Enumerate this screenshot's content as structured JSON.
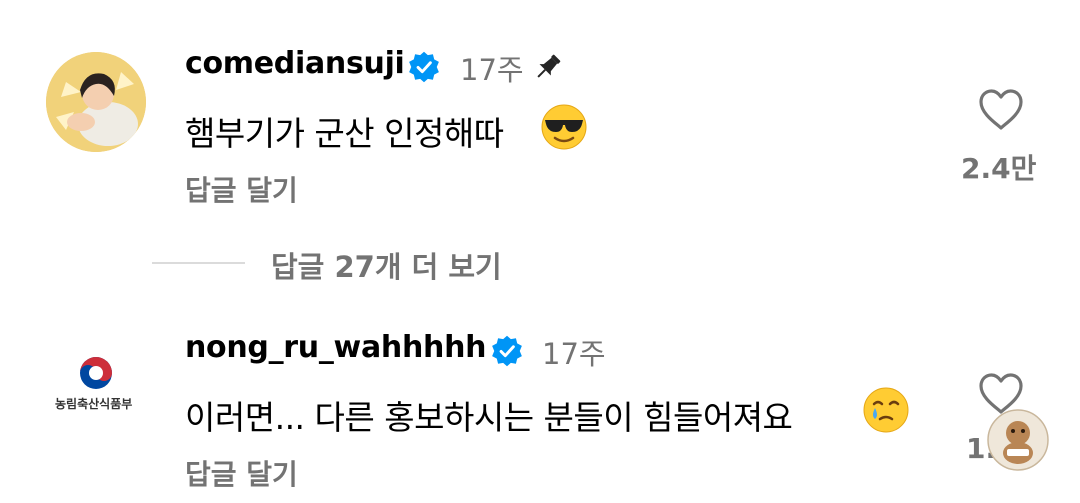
{
  "comments": [
    {
      "username": "comediansuji",
      "time": "17주",
      "text": "햄부기가 군산 인정해따",
      "reply_label": "답글 달기",
      "likes": "2.4만",
      "pinned": true,
      "verified": true,
      "emoji": "smiling-face-with-sunglasses"
    },
    {
      "username": "nong_ru_wahhhhh",
      "time": "17주",
      "text": "이러면... 다른 홍보하시는 분들이 힘들어져요",
      "reply_label": "답글 달기",
      "likes": "1.",
      "verified": true,
      "emoji": "face-holding-back-tears",
      "avatar_caption": "농림축산식품부"
    }
  ],
  "view_more_replies": "답글 27개 더 보기",
  "colors": {
    "verified_blue": "#0095f6",
    "muted": "#737373",
    "divider": "#dbdbdb"
  }
}
